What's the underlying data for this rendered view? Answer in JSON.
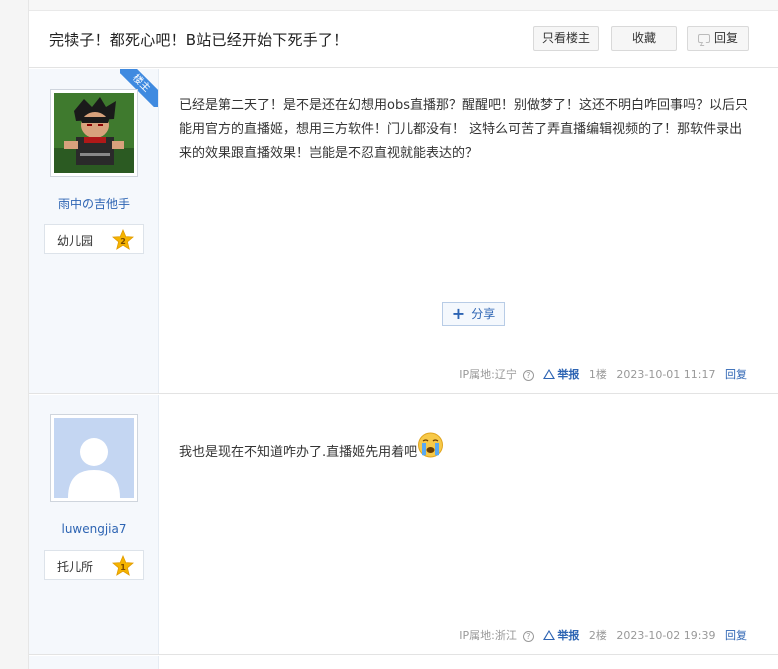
{
  "thread": {
    "title": "完犊子！都死心吧！B站已经开始下死手了！",
    "buttons": {
      "only_op": "只看楼主",
      "favorite": "收藏",
      "reply": "回复"
    }
  },
  "posts": [
    {
      "author": "雨中の吉他手",
      "level_name": "幼儿园",
      "level_num": "2",
      "badge": "楼主",
      "content": "已经是第二天了！是不是还在幻想用obs直播那？醒醒吧！别做梦了！这还不明白咋回事吗？以后只能用官方的直播姬，想用三方软件！门儿都没有！ 这特么可苦了弄直播编辑视频的了！那软件录出来的效果跟直播效果！岂能是不忍直视就能表达的？",
      "share_label": "分享",
      "ip": "IP属地:辽宁",
      "report": "举报",
      "floor": "1楼",
      "time": "2023-10-01 11:17",
      "reply": "回复"
    },
    {
      "author": "luwengjia7",
      "level_name": "托儿所",
      "level_num": "1",
      "content": "我也是现在不知道咋办了.直播姬先用着吧",
      "ip": "IP属地:浙江",
      "report": "举报",
      "floor": "2楼",
      "time": "2023-10-02 19:39",
      "reply": "回复"
    }
  ],
  "colors": {
    "link": "#2d64b3",
    "star": "#f5b400",
    "ribbon": "#3f8ae0",
    "author_bg": "#f5f8fc"
  },
  "icons": [
    "reply-icon",
    "star-icon",
    "plus-icon",
    "question-icon",
    "warning-icon",
    "crying-emoji"
  ]
}
